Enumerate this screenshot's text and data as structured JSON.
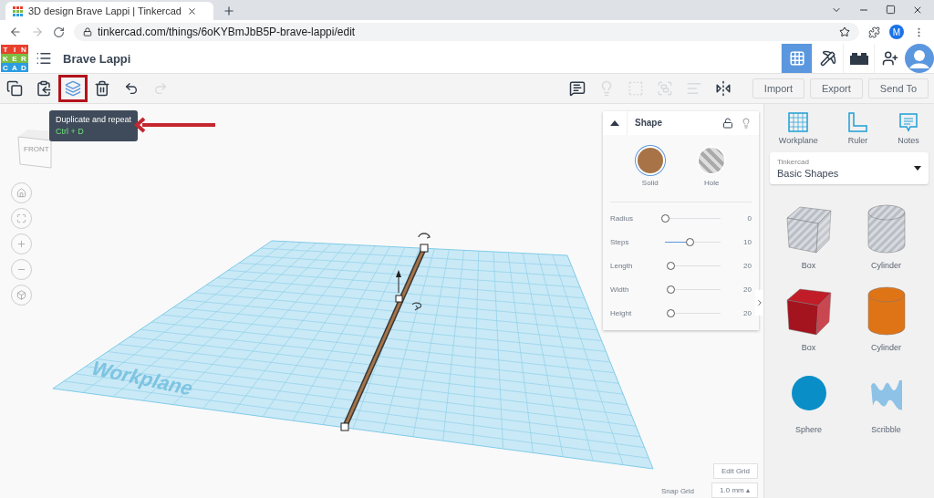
{
  "browser": {
    "tab_title": "3D design Brave Lappi | Tinkercad",
    "url": "tinkercad.com/things/6oKYBmJbB5P-brave-lappi/edit",
    "profile_initial": "M"
  },
  "header": {
    "logo_letters": [
      "T",
      "I",
      "N",
      "K",
      "E",
      "R",
      "C",
      "A",
      "D"
    ],
    "project_name": "Brave Lappi",
    "views": [
      {
        "kind": "grid",
        "selected": true
      },
      {
        "kind": "pickaxe",
        "selected": false
      },
      {
        "kind": "bricks",
        "selected": false
      }
    ]
  },
  "toolbar": {
    "tools": [
      {
        "kind": "copy",
        "highlighted": false,
        "disabled": false
      },
      {
        "kind": "paste",
        "highlighted": false,
        "disabled": false
      },
      {
        "kind": "duplicate",
        "highlighted": true,
        "disabled": false
      },
      {
        "kind": "delete",
        "highlighted": false,
        "disabled": false
      },
      {
        "kind": "undo",
        "highlighted": false,
        "disabled": false
      },
      {
        "kind": "redo",
        "highlighted": false,
        "disabled": true
      }
    ],
    "right_tools": [
      {
        "kind": "notes",
        "disabled": false
      },
      {
        "kind": "light",
        "disabled": true
      },
      {
        "kind": "group",
        "disabled": true
      },
      {
        "kind": "ungroup",
        "disabled": true
      },
      {
        "kind": "align",
        "disabled": true
      },
      {
        "kind": "mirror",
        "disabled": false
      }
    ],
    "actions": [
      "Import",
      "Export",
      "Send To"
    ]
  },
  "tooltip": {
    "title": "Duplicate and repeat",
    "shortcut": "Ctrl + D"
  },
  "canvas": {
    "view_cube_label": "FRONT",
    "workplane_label": "Workplane",
    "edit_grid": "Edit Grid",
    "snap_grid_label": "Snap Grid",
    "snap_grid_value": "1.0 mm",
    "snap_grid_caret": "▴"
  },
  "shape_panel": {
    "title": "Shape",
    "modes": [
      {
        "label": "Solid",
        "selected": true
      },
      {
        "label": "Hole",
        "selected": false
      }
    ],
    "params": [
      {
        "label": "Radius",
        "value": "0",
        "level": 0
      },
      {
        "label": "Steps",
        "value": "10",
        "level": 0.45
      },
      {
        "label": "Length",
        "value": "20",
        "level": 0
      },
      {
        "label": "Width",
        "value": "20",
        "level": 0
      },
      {
        "label": "Height",
        "value": "20",
        "level": 0
      }
    ]
  },
  "sidebar": {
    "tools": [
      {
        "kind": "workplane",
        "label": "Workplane"
      },
      {
        "kind": "ruler",
        "label": "Ruler"
      },
      {
        "kind": "notes",
        "label": "Notes"
      }
    ],
    "library": {
      "caption": "Tinkercad",
      "value": "Basic Shapes"
    },
    "shapes": [
      {
        "kind": "box-hole",
        "label": "Box"
      },
      {
        "kind": "cylinder-hole",
        "label": "Cylinder"
      },
      {
        "kind": "box",
        "label": "Box"
      },
      {
        "kind": "cylinder",
        "label": "Cylinder"
      },
      {
        "kind": "sphere",
        "label": "Sphere"
      },
      {
        "kind": "scribble",
        "label": "Scribble"
      }
    ]
  }
}
